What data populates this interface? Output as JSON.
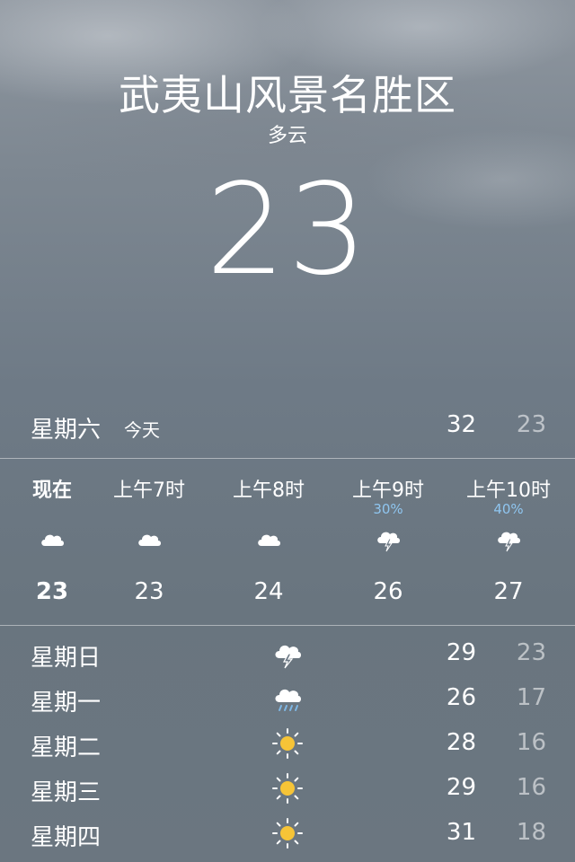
{
  "header": {
    "location": "武夷山风景名胜区",
    "condition": "多云",
    "temperature": "23"
  },
  "today": {
    "day": "星期六",
    "label": "今天",
    "high": "32",
    "low": "23"
  },
  "hourly": [
    {
      "time": "现在",
      "precip": "",
      "icon": "cloud-icon",
      "temp": "23"
    },
    {
      "time": "上午7时",
      "precip": "",
      "icon": "cloud-icon",
      "temp": "23"
    },
    {
      "time": "上午8时",
      "precip": "",
      "icon": "cloud-icon",
      "temp": "24"
    },
    {
      "time": "上午9时",
      "precip": "30%",
      "icon": "thunderstorm-icon",
      "temp": "26"
    },
    {
      "time": "上午10时",
      "precip": "40%",
      "icon": "thunderstorm-icon",
      "temp": "27"
    }
  ],
  "daily": [
    {
      "day": "星期日",
      "icon": "thunderstorm-icon",
      "high": "29",
      "low": "23"
    },
    {
      "day": "星期一",
      "icon": "rain-icon",
      "high": "26",
      "low": "17"
    },
    {
      "day": "星期二",
      "icon": "sun-icon",
      "high": "28",
      "low": "16"
    },
    {
      "day": "星期三",
      "icon": "sun-icon",
      "high": "29",
      "low": "16"
    },
    {
      "day": "星期四",
      "icon": "sun-icon",
      "high": "31",
      "low": "18"
    }
  ],
  "colors": {
    "precip": "#8fc6f0",
    "sun": "#f6c437",
    "rain_drops": "#7fb8e6"
  }
}
